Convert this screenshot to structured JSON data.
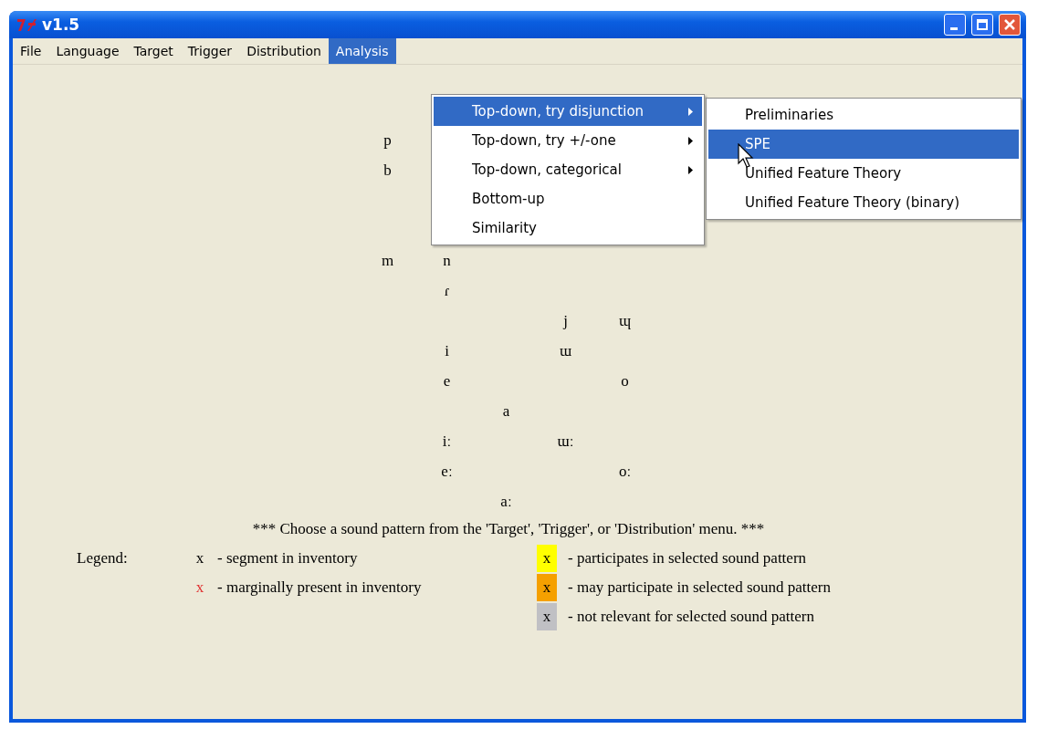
{
  "window": {
    "title": "v1.5"
  },
  "menu_bar": [
    {
      "label": "File",
      "selected": false
    },
    {
      "label": "Language",
      "selected": false
    },
    {
      "label": "Target",
      "selected": false
    },
    {
      "label": "Trigger",
      "selected": false
    },
    {
      "label": "Distribution",
      "selected": false
    },
    {
      "label": "Analysis",
      "selected": true
    }
  ],
  "analysis_menu": [
    {
      "label": "Top-down, try disjunction",
      "has_submenu": true,
      "selected": true
    },
    {
      "label": "Top-down, try +/-one",
      "has_submenu": true,
      "selected": false
    },
    {
      "label": "Top-down, categorical",
      "has_submenu": true,
      "selected": false
    },
    {
      "label": "Bottom-up",
      "has_submenu": false,
      "selected": false
    },
    {
      "label": "Similarity",
      "has_submenu": false,
      "selected": false
    }
  ],
  "submenu": [
    {
      "label": "Preliminaries",
      "selected": false
    },
    {
      "label": "SPE",
      "selected": true
    },
    {
      "label": "Unified Feature Theory",
      "selected": false
    },
    {
      "label": "Unified Feature Theory (binary)",
      "selected": false
    }
  ],
  "inventory": [
    [
      {
        "column_1": "p"
      },
      {
        "column_1": "b"
      }
    ],
    [
      {
        "column_1": "m",
        "column_2": "n"
      },
      {
        "column_2": "ɾ"
      },
      {
        "column_4": "j",
        "column_5": "ɰ"
      },
      {
        "column_2": "i",
        "column_4": "ɯ"
      },
      {
        "column_2": "e",
        "column_5": "o"
      },
      {
        "column_3": "a"
      },
      {
        "column_2": "iː",
        "column_4": "ɯː"
      },
      {
        "column_2": "eː",
        "column_5": "oː"
      },
      {
        "column_3": "aː"
      }
    ]
  ],
  "message": "*** Choose a sound pattern from the 'Target', 'Trigger', or 'Distribution' menu. ***",
  "legend": {
    "label": "Legend:",
    "segment_marks": [
      {
        "mark": "x",
        "color": "#000000",
        "text": "- segment in inventory"
      },
      {
        "mark": "x",
        "color": "#e03030",
        "text": "- marginally present in inventory"
      }
    ],
    "highlight_marks": [
      {
        "mark": "x",
        "color": "#ffff00",
        "text": "- participates in selected sound pattern"
      },
      {
        "mark": "x",
        "color": "#f5a000",
        "text": "- may participate in selected sound pattern"
      },
      {
        "mark": "x",
        "color": "#c0c0c4",
        "text": "- not relevant for selected sound pattern"
      }
    ]
  }
}
